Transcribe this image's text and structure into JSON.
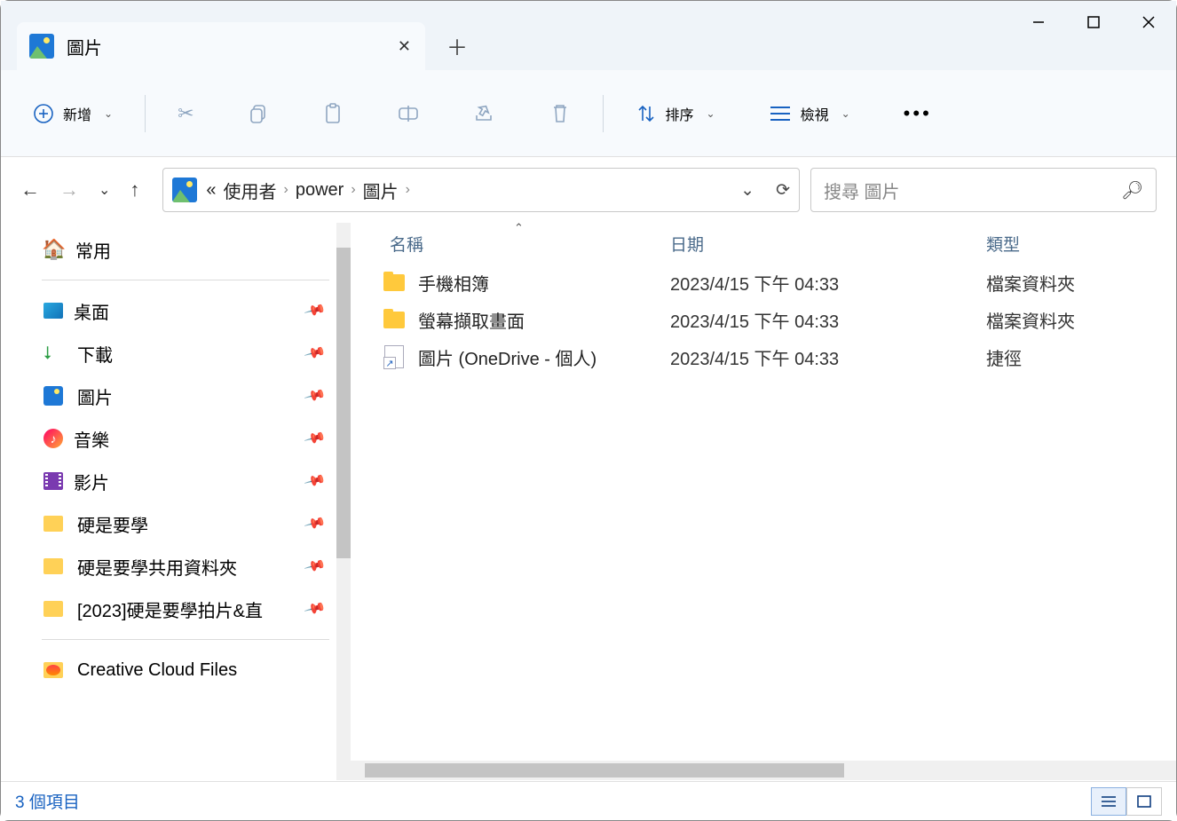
{
  "window": {
    "tab_title": "圖片"
  },
  "toolbar": {
    "new_label": "新增",
    "sort_label": "排序",
    "view_label": "檢視"
  },
  "nav": {
    "crumb_ellipsis": "«",
    "crumb1": "使用者",
    "crumb2": "power",
    "crumb3": "圖片",
    "search_placeholder": "搜尋 圖片"
  },
  "sidebar": {
    "home": "常用",
    "items": [
      {
        "label": "桌面",
        "pinned": true
      },
      {
        "label": "下載",
        "pinned": true
      },
      {
        "label": "圖片",
        "pinned": true
      },
      {
        "label": "音樂",
        "pinned": true
      },
      {
        "label": "影片",
        "pinned": true
      },
      {
        "label": "硬是要學",
        "pinned": true
      },
      {
        "label": "硬是要學共用資料夾",
        "pinned": true
      },
      {
        "label": "[2023]硬是要學拍片&直",
        "pinned": true
      }
    ],
    "bottom1": "Creative Cloud Files"
  },
  "columns": {
    "name": "名稱",
    "date": "日期",
    "type": "類型"
  },
  "files": [
    {
      "name": "手機相簿",
      "date": "2023/4/15 下午 04:33",
      "type": "檔案資料夾",
      "kind": "folder"
    },
    {
      "name": "螢幕擷取畫面",
      "date": "2023/4/15 下午 04:33",
      "type": "檔案資料夾",
      "kind": "folder"
    },
    {
      "name": "圖片 (OneDrive - 個人)",
      "date": "2023/4/15 下午 04:33",
      "type": "捷徑",
      "kind": "shortcut"
    }
  ],
  "status": {
    "count_text": "3 個項目"
  }
}
